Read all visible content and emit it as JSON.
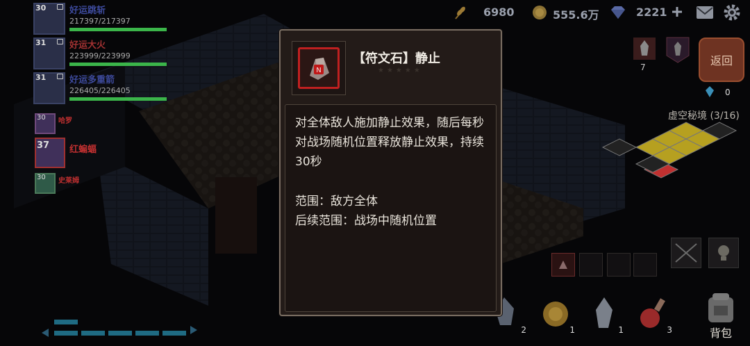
{
  "party": [
    {
      "level": "30",
      "name": "好运跳斩",
      "hp": "217397/217397",
      "hp_fraction": 1.0
    },
    {
      "level": "31",
      "name": "好运大火",
      "hp": "223999/223999",
      "hp_fraction": 1.0
    },
    {
      "level": "31",
      "name": "好运多重箭",
      "hp": "226405/226405",
      "hp_fraction": 1.0
    }
  ],
  "enemies": [
    {
      "level": "30",
      "name": "哈罗"
    },
    {
      "level": "37",
      "name": "红蝙蝠"
    },
    {
      "level": "30",
      "name": "史莱姆"
    }
  ],
  "resources": {
    "wheat": "6980",
    "gold": "555.6万",
    "diamond": "2221"
  },
  "right_panel": {
    "tower_count": "7",
    "return_label": "返回",
    "crystal_count": "0",
    "dungeon_title": "虚空秘境 (3/16)"
  },
  "tooltip": {
    "title": "【符文石】静止",
    "icon_letter": "N",
    "description": "对全体敌人施加静止效果，随后每秒对战场随机位置释放静止效果，持续30秒",
    "range": "范围：敌方全体",
    "follow_range": "后续范围：战场中随机位置"
  },
  "inventory": [
    {
      "name": "stone-item",
      "count": "2"
    },
    {
      "name": "gold-coin-item",
      "count": "1"
    },
    {
      "name": "crystal-item",
      "count": "1"
    },
    {
      "name": "potion-item",
      "count": "3"
    }
  ],
  "bag_label": "背包",
  "colors": {
    "accent_red": "#c02020",
    "hp_green": "#3bb54a",
    "modal_bg": "#231b18",
    "modal_border": "#7a6e62"
  }
}
